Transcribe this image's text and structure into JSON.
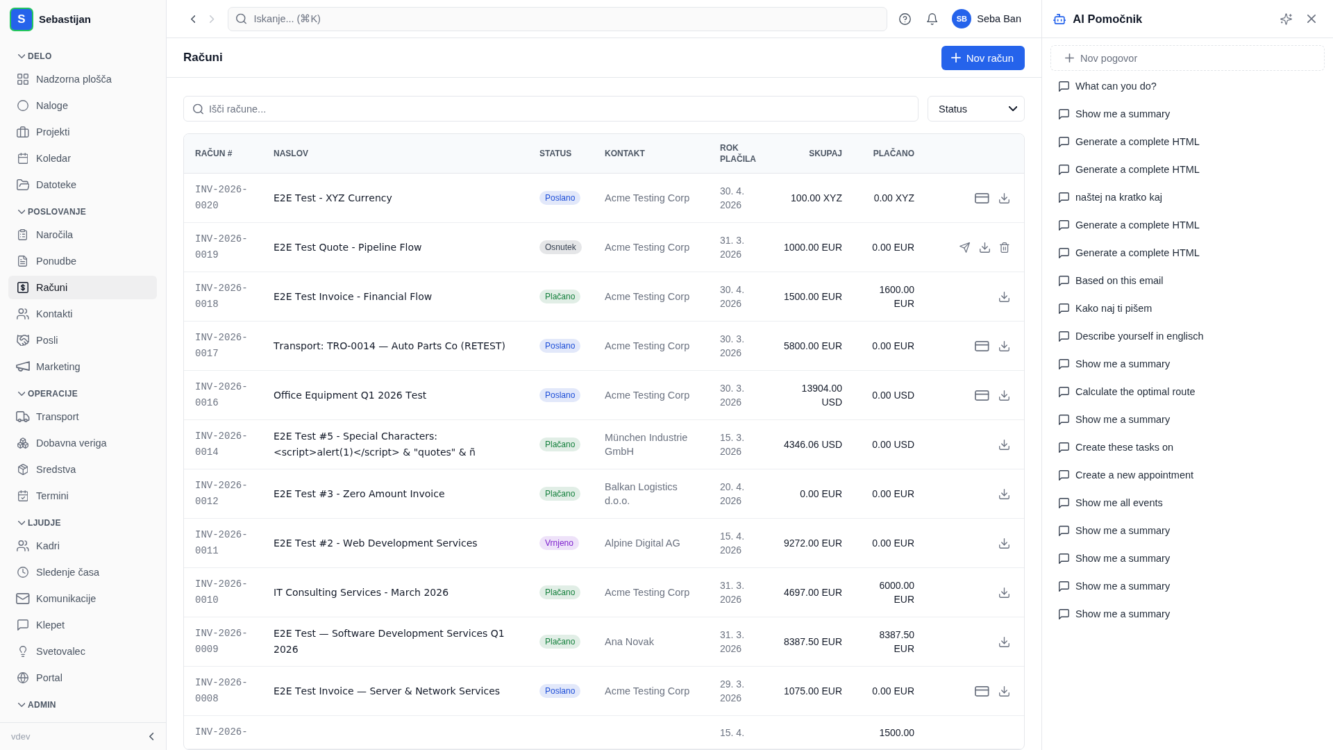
{
  "sidebar": {
    "workspace": {
      "initial": "S",
      "name": "Sebastijan"
    },
    "sections": [
      {
        "title": "DELO",
        "expanded": true,
        "items": [
          {
            "label": "Nadzorna plošča",
            "kind": "dashboard",
            "selected": false
          },
          {
            "label": "Naloge",
            "kind": "tasks",
            "selected": false
          },
          {
            "label": "Projekti",
            "kind": "projects",
            "selected": false
          },
          {
            "label": "Koledar",
            "kind": "calendar",
            "selected": false
          },
          {
            "label": "Datoteke",
            "kind": "files",
            "selected": false
          }
        ]
      },
      {
        "title": "POSLOVANJE",
        "expanded": true,
        "items": [
          {
            "label": "Naročila",
            "kind": "orders",
            "selected": false
          },
          {
            "label": "Ponudbe",
            "kind": "quotes",
            "selected": false
          },
          {
            "label": "Računi",
            "kind": "invoices",
            "selected": true
          },
          {
            "label": "Kontakti",
            "kind": "contacts",
            "selected": false
          },
          {
            "label": "Posli",
            "kind": "deals",
            "selected": false
          },
          {
            "label": "Marketing",
            "kind": "marketing",
            "selected": false
          }
        ]
      },
      {
        "title": "OPERACIJE",
        "expanded": true,
        "items": [
          {
            "label": "Transport",
            "kind": "transport",
            "selected": false
          },
          {
            "label": "Dobavna veriga",
            "kind": "supply",
            "selected": false
          },
          {
            "label": "Sredstva",
            "kind": "assets",
            "selected": false
          },
          {
            "label": "Termini",
            "kind": "appointments",
            "selected": false
          }
        ]
      },
      {
        "title": "LJUDJE",
        "expanded": true,
        "items": [
          {
            "label": "Kadri",
            "kind": "people",
            "selected": false
          },
          {
            "label": "Sledenje časa",
            "kind": "time",
            "selected": false
          },
          {
            "label": "Komunikacije",
            "kind": "communication",
            "selected": false
          },
          {
            "label": "Klepet",
            "kind": "chat",
            "selected": false
          },
          {
            "label": "Svetovalec",
            "kind": "advisor",
            "selected": false
          },
          {
            "label": "Portal",
            "kind": "portal",
            "selected": false
          }
        ]
      },
      {
        "title": "ADMIN",
        "expanded": true
      }
    ],
    "version": "vdev"
  },
  "topbar": {
    "back": {
      "disabled": false
    },
    "forward": {
      "disabled": true
    },
    "search": {
      "placeholder": "Iskanje... (⌘K)"
    },
    "user": {
      "initials": "SB",
      "name": "Seba Ban"
    }
  },
  "page": {
    "title": "Računi",
    "new_button": "Nov račun"
  },
  "filters": {
    "search": {
      "placeholder": "Išči račune..."
    },
    "status": {
      "value": "Status"
    }
  },
  "table": {
    "columns": [
      "RAČUN #",
      "NASLOV",
      "STATUS",
      "KONTAKT",
      "ROK PLAČILA",
      "SKUPAJ",
      "PLAČANO"
    ],
    "rows": [
      {
        "number": "INV-2026-0020",
        "title": "E2E Test - XYZ Currency",
        "status": {
          "label": "Poslano",
          "color": "#1d4ed8"
        },
        "contact": "Acme Testing Corp",
        "due": "30. 4. 2026",
        "total": "100.00 XYZ",
        "paid": "0.00 XYZ",
        "actions": [
          {
            "kind": "pay"
          },
          {
            "kind": "download"
          }
        ]
      },
      {
        "number": "INV-2026-0019",
        "title": "E2E Test Quote - Pipeline Flow",
        "status": {
          "label": "Osnutek",
          "color": "#374151"
        },
        "contact": "Acme Testing Corp",
        "due": "31. 3. 2026",
        "total": "1000.00 EUR",
        "paid": "0.00 EUR",
        "actions": [
          {
            "kind": "send"
          },
          {
            "kind": "download"
          },
          {
            "kind": "delete"
          }
        ]
      },
      {
        "number": "INV-2026-0018",
        "title": "E2E Test Invoice - Financial Flow",
        "status": {
          "label": "Plačano",
          "color": "#15803d"
        },
        "contact": "Acme Testing Corp",
        "due": "30. 4. 2026",
        "total": "1500.00 EUR",
        "paid": "1600.00 EUR",
        "actions": [
          {
            "kind": "download"
          }
        ]
      },
      {
        "number": "INV-2026-0017",
        "title": "Transport: TRO-0014 — Auto Parts Co (RETEST)",
        "status": {
          "label": "Poslano",
          "color": "#1d4ed8"
        },
        "contact": "Acme Testing Corp",
        "due": "30. 3. 2026",
        "total": "5800.00 EUR",
        "paid": "0.00 EUR",
        "actions": [
          {
            "kind": "pay"
          },
          {
            "kind": "download"
          }
        ]
      },
      {
        "number": "INV-2026-0016",
        "title": "Office Equipment Q1 2026 Test",
        "status": {
          "label": "Poslano",
          "color": "#1d4ed8"
        },
        "contact": "Acme Testing Corp",
        "due": "30. 3. 2026",
        "total": "13904.00 USD",
        "paid": "0.00 USD",
        "actions": [
          {
            "kind": "pay"
          },
          {
            "kind": "download"
          }
        ]
      },
      {
        "number": "INV-2026-0014",
        "title": "E2E Test #5 - Special Characters: <script>alert(1)</script> & \"quotes\" & ñ",
        "status": {
          "label": "Plačano",
          "color": "#15803d"
        },
        "contact": "München Industrie GmbH",
        "due": "15. 3. 2026",
        "total": "4346.06 USD",
        "paid": "0.00 USD",
        "actions": [
          {
            "kind": "download"
          }
        ]
      },
      {
        "number": "INV-2026-0012",
        "title": "E2E Test #3 - Zero Amount Invoice",
        "status": {
          "label": "Plačano",
          "color": "#15803d"
        },
        "contact": "Balkan Logistics d.o.o.",
        "due": "20. 4. 2026",
        "total": "0.00 EUR",
        "paid": "0.00 EUR",
        "actions": [
          {
            "kind": "download"
          }
        ]
      },
      {
        "number": "INV-2026-0011",
        "title": "E2E Test #2 - Web Development Services",
        "status": {
          "label": "Vrnjeno",
          "color": "#7e22ce"
        },
        "contact": "Alpine Digital AG",
        "due": "15. 4. 2026",
        "total": "9272.00 EUR",
        "paid": "0.00 EUR",
        "actions": [
          {
            "kind": "download"
          }
        ]
      },
      {
        "number": "INV-2026-0010",
        "title": "IT Consulting Services - March 2026",
        "status": {
          "label": "Plačano",
          "color": "#15803d"
        },
        "contact": "Acme Testing Corp",
        "due": "31. 3. 2026",
        "total": "4697.00 EUR",
        "paid": "6000.00 EUR",
        "actions": [
          {
            "kind": "download"
          }
        ]
      },
      {
        "number": "INV-2026-0009",
        "title": "E2E Test — Software Development Services Q1 2026",
        "status": {
          "label": "Plačano",
          "color": "#15803d"
        },
        "contact": "Ana Novak",
        "due": "31. 3. 2026",
        "total": "8387.50 EUR",
        "paid": "8387.50 EUR",
        "actions": [
          {
            "kind": "download"
          }
        ]
      },
      {
        "number": "INV-2026-0008",
        "title": "E2E Test Invoice — Server & Network Services",
        "status": {
          "label": "Poslano",
          "color": "#1d4ed8"
        },
        "contact": "Acme Testing Corp",
        "due": "29. 3. 2026",
        "total": "1075.00 EUR",
        "paid": "0.00 EUR",
        "actions": [
          {
            "kind": "pay"
          },
          {
            "kind": "download"
          }
        ]
      },
      {
        "number": "INV-2026-",
        "due": "15. 4.",
        "paid": "1500.00"
      }
    ]
  },
  "assistant": {
    "title": "AI Pomočnik",
    "new_chat": "Nov pogovor",
    "conversations": [
      {
        "title": "What can you do?",
        "selected": false
      },
      {
        "title": "Show me a summary",
        "selected": false
      },
      {
        "title": "Generate a complete HTML",
        "selected": false
      },
      {
        "title": "Generate a complete HTML",
        "selected": false
      },
      {
        "title": "naštej na kratko kaj",
        "selected": false
      },
      {
        "title": "Generate a complete HTML",
        "selected": false
      },
      {
        "title": "Generate a complete HTML",
        "selected": false
      },
      {
        "title": "Based on this email",
        "selected": false
      },
      {
        "title": "Kako naj ti pišem",
        "selected": false
      },
      {
        "title": "Describe yourself in englisch",
        "selected": false
      },
      {
        "title": "Show me a summary",
        "selected": false
      },
      {
        "title": "Calculate the optimal route",
        "selected": false
      },
      {
        "title": "Show me a summary",
        "selected": false
      },
      {
        "title": "Create these tasks on",
        "selected": false
      },
      {
        "title": "Create a new appointment",
        "selected": false
      },
      {
        "title": "Show me all events",
        "selected": false
      },
      {
        "title": "Show me a summary",
        "selected": false
      },
      {
        "title": "Show me a summary",
        "selected": false
      },
      {
        "title": "Show me a summary",
        "selected": false
      },
      {
        "title": "Show me a summary",
        "selected": false
      }
    ]
  }
}
